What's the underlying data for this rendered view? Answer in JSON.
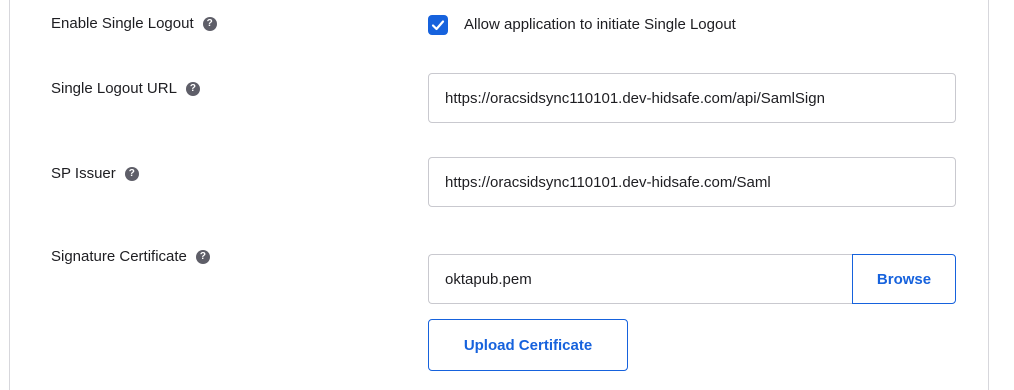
{
  "single_logout": {
    "label": "Enable Single Logout",
    "checkbox_label": "Allow application to initiate Single Logout",
    "checked": true
  },
  "logout_url": {
    "label": "Single Logout URL",
    "value": "https://oracsidsync110101.dev-hidsafe.com/api/SamlSign"
  },
  "sp_issuer": {
    "label": "SP Issuer",
    "value": "https://oracsidsync110101.dev-hidsafe.com/Saml"
  },
  "signature_certificate": {
    "label": "Signature Certificate",
    "file_name": "oktapub.pem",
    "browse_label": "Browse",
    "upload_label": "Upload Certificate"
  },
  "help_icon_glyph": "?",
  "colors": {
    "accent": "#1662dd",
    "help_icon": "#5e5e68",
    "border": "#c9c9cf",
    "text": "#1d1d21"
  }
}
